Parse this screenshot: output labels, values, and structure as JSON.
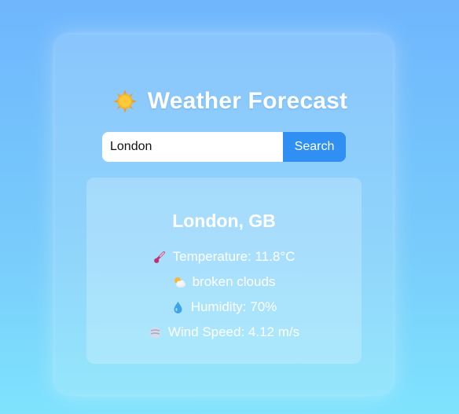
{
  "app": {
    "title": "Weather Forecast",
    "title_icon": "sun-icon"
  },
  "search": {
    "value": "London",
    "placeholder": "",
    "button_label": "Search"
  },
  "result": {
    "city": "London, GB",
    "temperature": "Temperature: 11.8°C",
    "description": "broken clouds",
    "humidity": "Humidity: 70%",
    "wind": "Wind Speed: 4.12 m/s",
    "icons": [
      "thermometer-icon",
      "cloud-sun-icon",
      "droplet-icon",
      "wind-icon"
    ]
  },
  "colors": {
    "background_top": "#6fb6fd",
    "background_bottom": "#7fe3fd",
    "button": "#2f8ff2",
    "text": "#ffffff"
  }
}
